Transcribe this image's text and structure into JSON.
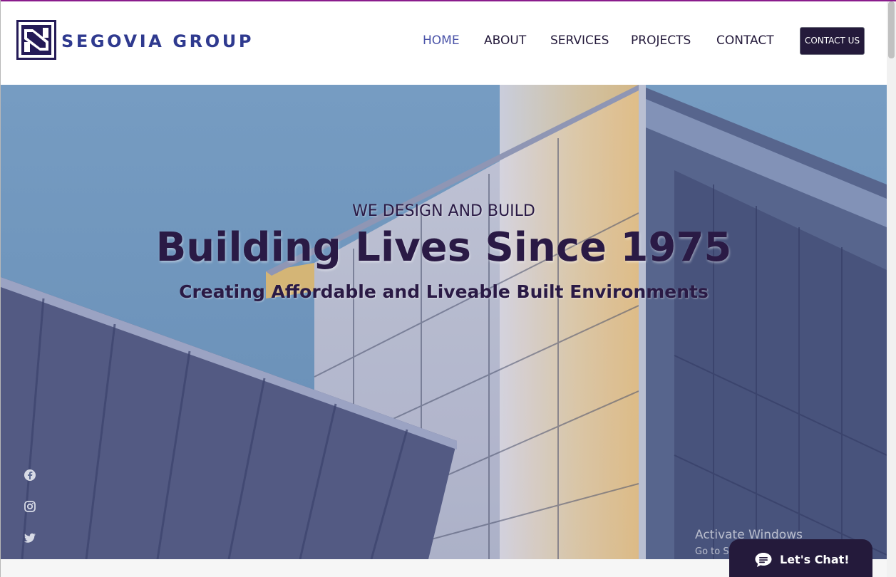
{
  "brand": {
    "name": "SEGOVIA GROUP",
    "logo_letter": "S",
    "color": "#2f3a8f",
    "mark_color": "#241a57"
  },
  "nav": {
    "items": [
      {
        "label": "HOME",
        "active": true
      },
      {
        "label": "ABOUT",
        "active": false
      },
      {
        "label": "SERVICES",
        "active": false
      },
      {
        "label": "PROJECTS",
        "active": false
      },
      {
        "label": "CONTACT",
        "active": false
      }
    ],
    "cta_label": "CONTACT US",
    "active_color": "#4a53a8",
    "text_color": "#241a3b"
  },
  "hero": {
    "eyebrow": "WE DESIGN AND BUILD",
    "title": "Building Lives Since 1975",
    "subtitle": "Creating Affordable and Liveable Built Environments",
    "text_color": "#2a1a45",
    "sky_color": "#7aa3c9"
  },
  "social": [
    {
      "icon": "facebook-icon"
    },
    {
      "icon": "instagram-icon"
    },
    {
      "icon": "twitter-icon"
    }
  ],
  "windows_watermark": {
    "title": "Activate Windows",
    "subtitle": "Go to Settings to activate Windows."
  },
  "chat": {
    "label": "Let's Chat!",
    "icon": "chat-bubble-icon",
    "background": "#241a3b"
  },
  "accent": {
    "top_rule": "#8a1c8c"
  }
}
